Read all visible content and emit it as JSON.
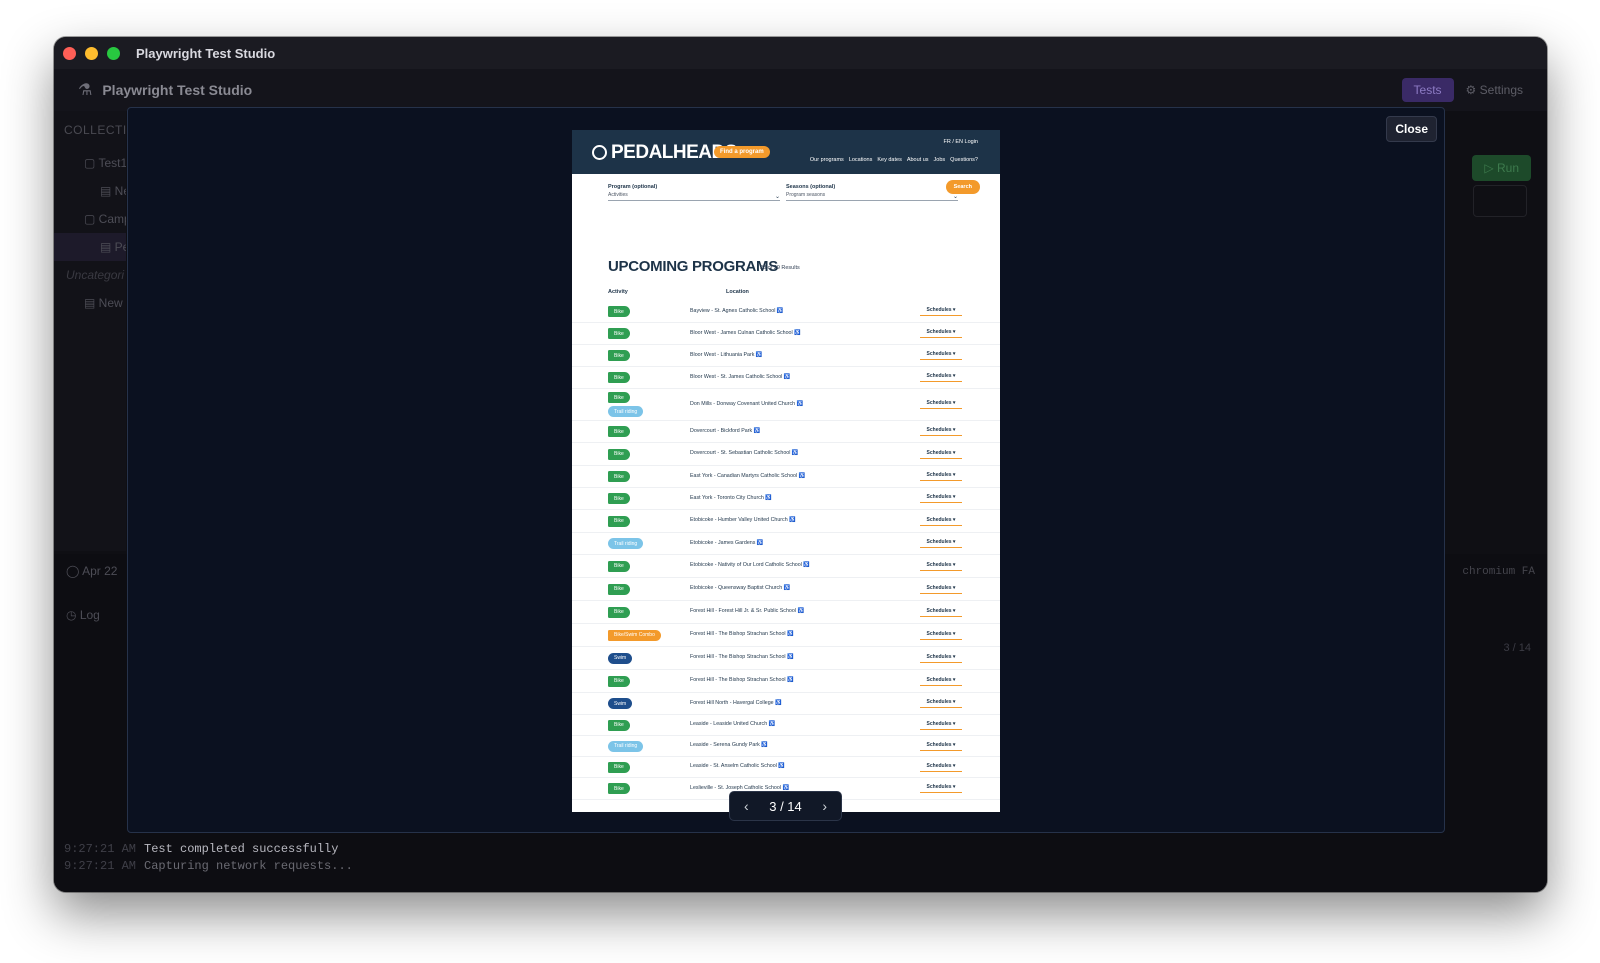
{
  "window": {
    "title": "Playwright Test Studio"
  },
  "app": {
    "title": "Playwright Test Studio",
    "tab_tests": "Tests",
    "tab_settings": "Settings",
    "run_label": "Run"
  },
  "sidebar": {
    "heading": "COLLECTIO",
    "items": [
      {
        "label": "Test1"
      },
      {
        "label": "Ne"
      },
      {
        "label": "Camp"
      },
      {
        "label": "Pe"
      },
      {
        "label": "Uncategori"
      },
      {
        "label": "New"
      }
    ]
  },
  "bottom": {
    "date": "Apr 22",
    "log_tab": "Log",
    "browser": "chromium",
    "browser_suffix": "FA",
    "count": "3 / 14",
    "log_lines": [
      {
        "ts": "9:27:21 AM",
        "msg": "Test completed successfully"
      },
      {
        "ts": "9:27:21 AM",
        "msg": "Capturing network requests..."
      }
    ]
  },
  "modal": {
    "close_label": "Close",
    "pager": {
      "text": "3 / 14",
      "prev": "‹",
      "next": "›"
    }
  },
  "screenshot": {
    "brand": "PEDALHEADS",
    "find_program": "Find a program",
    "top_links": "FR / EN   Login",
    "nav_links": [
      "Our programs",
      "Locations",
      "Key dates",
      "About us",
      "Jobs",
      "Questions?"
    ],
    "filter_program_label": "Program (optional)",
    "filter_program_value": "Activities",
    "filter_season_label": "Seasons (optional)",
    "filter_season_value": "Program seasons",
    "search_label": "Search",
    "heading": "UPCOMING PROGRAMS",
    "results": "28 of 29 Results",
    "col_activity": "Activity",
    "col_location": "Location",
    "schedules_label": "Schedules ▾",
    "rows": [
      {
        "acts": [
          {
            "label": "Bike",
            "kind": "bike"
          }
        ],
        "loc": "Bayview - St. Agnes Catholic School"
      },
      {
        "acts": [
          {
            "label": "Bike",
            "kind": "bike"
          }
        ],
        "loc": "Bloor West - James Culnan Catholic School"
      },
      {
        "acts": [
          {
            "label": "Bike",
            "kind": "bike"
          }
        ],
        "loc": "Bloor West - Lithuania Park"
      },
      {
        "acts": [
          {
            "label": "Bike",
            "kind": "bike"
          }
        ],
        "loc": "Bloor West - St. James Catholic School"
      },
      {
        "acts": [
          {
            "label": "Bike",
            "kind": "bike"
          },
          {
            "label": "Trail riding",
            "kind": "trail"
          }
        ],
        "loc": "Don Mills - Donway Covenant United Church"
      },
      {
        "acts": [
          {
            "label": "Bike",
            "kind": "bike"
          }
        ],
        "loc": "Dovercourt - Bickford Park"
      },
      {
        "acts": [
          {
            "label": "Bike",
            "kind": "bike"
          }
        ],
        "loc": "Dovercourt - St. Sebastian Catholic School"
      },
      {
        "acts": [
          {
            "label": "Bike",
            "kind": "bike"
          }
        ],
        "loc": "East York - Canadian Martyrs Catholic School"
      },
      {
        "acts": [
          {
            "label": "Bike",
            "kind": "bike"
          }
        ],
        "loc": "East York - Toronto City Church"
      },
      {
        "acts": [
          {
            "label": "Bike",
            "kind": "bike"
          }
        ],
        "loc": "Etobicoke - Humber Valley United Church"
      },
      {
        "acts": [
          {
            "label": "Trail riding",
            "kind": "trail"
          }
        ],
        "loc": "Etobicoke - James Gardens"
      },
      {
        "acts": [
          {
            "label": "Bike",
            "kind": "bike"
          }
        ],
        "loc": "Etobicoke - Nativity of Our Lord Catholic School"
      },
      {
        "acts": [
          {
            "label": "Bike",
            "kind": "bike"
          }
        ],
        "loc": "Etobicoke - Queensway Baptist Church"
      },
      {
        "acts": [
          {
            "label": "Bike",
            "kind": "bike"
          }
        ],
        "loc": "Forest Hill - Forest Hill Jr. & Sr. Public School"
      },
      {
        "acts": [
          {
            "label": "Bike/Swim Combo",
            "kind": "combo"
          }
        ],
        "loc": "Forest Hill - The Bishop Strachan School"
      },
      {
        "acts": [
          {
            "label": "Swim",
            "kind": "swim"
          }
        ],
        "loc": "Forest Hill - The Bishop Strachan School"
      },
      {
        "acts": [
          {
            "label": "Bike",
            "kind": "bike"
          }
        ],
        "loc": "Forest Hill - The Bishop Strachan School"
      },
      {
        "acts": [
          {
            "label": "Swim",
            "kind": "swim"
          }
        ],
        "loc": "Forest Hill North - Havergal College"
      },
      {
        "acts": [
          {
            "label": "Bike",
            "kind": "bike"
          }
        ],
        "loc": "Leaside - Leaside United Church"
      },
      {
        "acts": [
          {
            "label": "Trail riding",
            "kind": "trail"
          }
        ],
        "loc": "Leaside - Serena Gundy Park"
      },
      {
        "acts": [
          {
            "label": "Bike",
            "kind": "bike"
          }
        ],
        "loc": "Leaside - St. Anselm Catholic School"
      },
      {
        "acts": [
          {
            "label": "Bike",
            "kind": "bike"
          }
        ],
        "loc": "Leslieville - St. Joseph Catholic School"
      }
    ]
  }
}
